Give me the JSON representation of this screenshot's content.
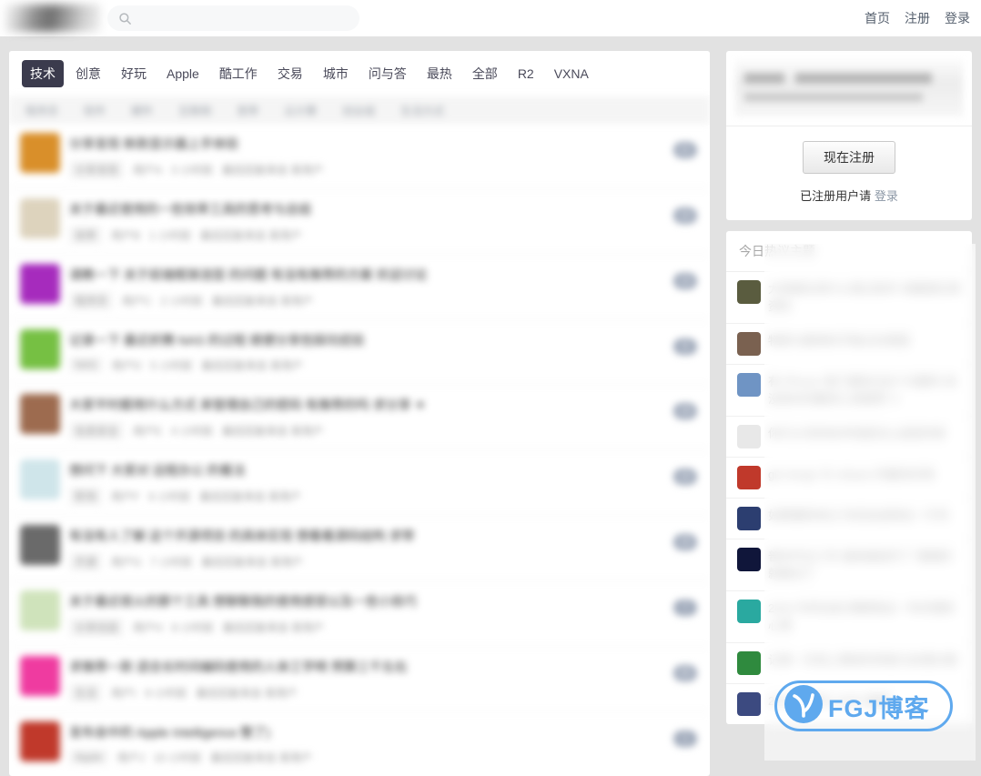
{
  "header": {
    "logo_alt": "v2ex-logo",
    "search": {
      "value": "",
      "placeholder": ""
    },
    "nav": [
      {
        "label": "首页",
        "name": "nav-home"
      },
      {
        "label": "注册",
        "name": "nav-register"
      },
      {
        "label": "登录",
        "name": "nav-login"
      }
    ]
  },
  "tabs": [
    {
      "label": "技术",
      "active": true
    },
    {
      "label": "创意",
      "active": false
    },
    {
      "label": "好玩",
      "active": false
    },
    {
      "label": "Apple",
      "active": false
    },
    {
      "label": "酷工作",
      "active": false
    },
    {
      "label": "交易",
      "active": false
    },
    {
      "label": "城市",
      "active": false
    },
    {
      "label": "问与答",
      "active": false
    },
    {
      "label": "最热",
      "active": false
    },
    {
      "label": "全部",
      "active": false
    },
    {
      "label": "R2",
      "active": false
    },
    {
      "label": "VXNA",
      "active": false
    }
  ],
  "subtabs": [
    {
      "label": "程序员"
    },
    {
      "label": "软件"
    },
    {
      "label": "硬件"
    },
    {
      "label": "互联网"
    },
    {
      "label": "宽带"
    },
    {
      "label": "云计算"
    },
    {
      "label": "创业组"
    },
    {
      "label": "生活方式"
    }
  ],
  "topics": [
    {
      "title": "分享发现 新款显示器上手体验",
      "author": "用户A",
      "node": "分享发现",
      "time": "3 小时前",
      "last_reply": "最后回复来自 某用户",
      "replies": "21",
      "avatar": "#d98f2a"
    },
    {
      "title": "关于最近使用的一些效率工具的思考与总结",
      "author": "用户B",
      "node": "效率",
      "time": "1 小时前",
      "last_reply": "最后回复来自 某用户",
      "replies": "10",
      "avatar": "#ddd3bd"
    },
    {
      "title": "请教一下 关于前端框架选型 的问题 有没有推荐的方案 欢迎讨论",
      "author": "用户C",
      "node": "程序员",
      "time": "2 小时前",
      "last_reply": "最后回复来自 某用户",
      "replies": "13",
      "avatar": "#a62bbd"
    },
    {
      "title": "记录一下 最近折腾 NAS 的过程 顺便分享些踩坑经验",
      "author": "用户D",
      "node": "NAS",
      "time": "5 小时前",
      "last_reply": "最后回复来自 某用户",
      "replies": "8",
      "avatar": "#76c043"
    },
    {
      "title": "大家平时都用什么方式 来管理自己的密码 有推荐的吗 求分享 ☀",
      "author": "用户E",
      "node": "信息安全",
      "time": "4 小时前",
      "last_reply": "最后回复来自 某用户",
      "replies": "19",
      "avatar": "#9d6b4f"
    },
    {
      "title": "想问下 大家对 远程办公 的看法",
      "author": "用户F",
      "node": "职场",
      "time": "6 小时前",
      "last_reply": "最后回复来自 某用户",
      "replies": "10",
      "avatar": "#cfe5ea"
    },
    {
      "title": "有没有人了解 这个开源项目 的具体实现 想看看源码结构 求带",
      "author": "用户G",
      "node": "开源",
      "time": "7 小时前",
      "last_reply": "最后回复来自 某用户",
      "replies": "15",
      "avatar": "#6a6a6a"
    },
    {
      "title": "关于最近很火的那个工具 想聊聊我的使用感受以及一些小技巧",
      "author": "用户H",
      "node": "分享创造",
      "time": "8 小时前",
      "last_reply": "最后回复来自 某用户",
      "replies": "7",
      "avatar": "#cfe3bb"
    },
    {
      "title": "求推荐一款 适合长时间编码使用的人体工学椅 预算三千左右",
      "author": "用户I",
      "node": "生活",
      "time": "9 小时前",
      "last_reply": "最后回复来自 某用户",
      "replies": "20",
      "avatar": "#ef3ba0"
    },
    {
      "title": "发布会中的 Apple Intelligence 整了)",
      "author": "用户J",
      "node": "Apple",
      "time": "10 小时前",
      "last_reply": "最后回复来自 某用户",
      "replies": "1",
      "avatar": "#c0392b"
    }
  ],
  "sidebar": {
    "promo": {
      "register_button": "现在注册",
      "note_prefix": "已注册用户请",
      "login_link": "登录"
    },
    "hot": {
      "header": "今日热议主题",
      "items": [
        {
          "title": "大家都在用什么笔记软件 来整理日常资料",
          "avatar": "#5a5c3f"
        },
        {
          "title": "物质与精神的平衡点在哪里",
          "avatar": "#7a6150"
        },
        {
          "title": "有 iPhone 用户遇到过这个问题吗 有没有好的翻译工具推荐 ☀",
          "avatar": "#6f94c4"
        },
        {
          "title": "你们公司的技术栈是怎么选型的呢",
          "avatar": "#e8e8e8"
        },
        {
          "title": "git merge 与 rebase 的最佳实践",
          "avatar": "#c0392b"
        },
        {
          "title": "如果重新来过 你还会选择这一行吗",
          "avatar": "#2c3e70"
        },
        {
          "title": "普本毕业三年 越来越迷茫了 慢慢的就看淡了",
          "avatar": "#10163a"
        },
        {
          "title": "2024 年终总结 聊聊我这一年的理财心得",
          "avatar": "#2aa9a0"
        },
        {
          "title": "记录一次线上事故的排查与处理过程",
          "avatar": "#2f8a3e"
        },
        {
          "title": "2024 回顾与 2025 展望",
          "avatar": "#3c4a80"
        }
      ]
    }
  },
  "watermark": {
    "text": "FGJ博客",
    "color": "#5fa9ee"
  }
}
